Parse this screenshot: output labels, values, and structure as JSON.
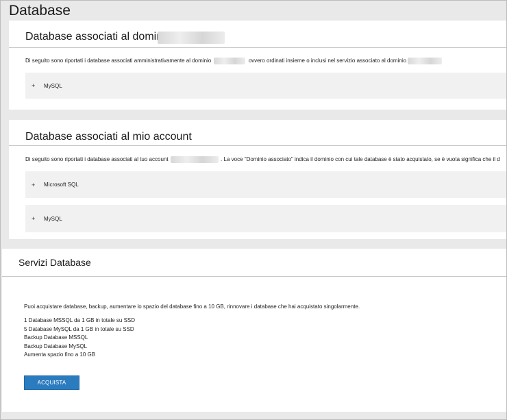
{
  "page": {
    "title": "Database"
  },
  "domain_section": {
    "title": "Database associati al dominio",
    "description_part1": "Di seguito sono riportati i database associati amministrativamente al dominio",
    "description_part2": "ovvero ordinati insieme o inclusi nel servizio associato al dominio",
    "items": [
      {
        "label": "MySQL",
        "expand": "+"
      }
    ]
  },
  "account_section": {
    "title": "Database associati al mio account",
    "description_part1": "Di seguito sono riportati i database associati al tuo account",
    "description_part2": ". La voce \"Dominio associato\" indica il dominio con cui tale database è stato acquistato, se è vuota significa che il d",
    "items": [
      {
        "label": "Microsoft SQL",
        "expand": "+"
      },
      {
        "label": "MySQL",
        "expand": "+"
      }
    ]
  },
  "services_section": {
    "title": "Servizi Database",
    "intro": "Puoi acquistare database, backup, aumentare lo spazio del database fino a 10 GB, rinnovare i database che hai acquistato singolarmente.",
    "list": [
      "1 Database MSSQL da 1 GB in totale su SSD",
      "5 Database MySQL da 1 GB in totale su SSD",
      "Backup Database MSSQL",
      "Backup Database MySQL",
      "Aumenta spazio fino a 10 GB"
    ],
    "button_label": "ACQUISTA"
  },
  "colors": {
    "button": "#2b7bbf",
    "accordion": "#f1f1f1",
    "background": "#e9e9e9"
  }
}
